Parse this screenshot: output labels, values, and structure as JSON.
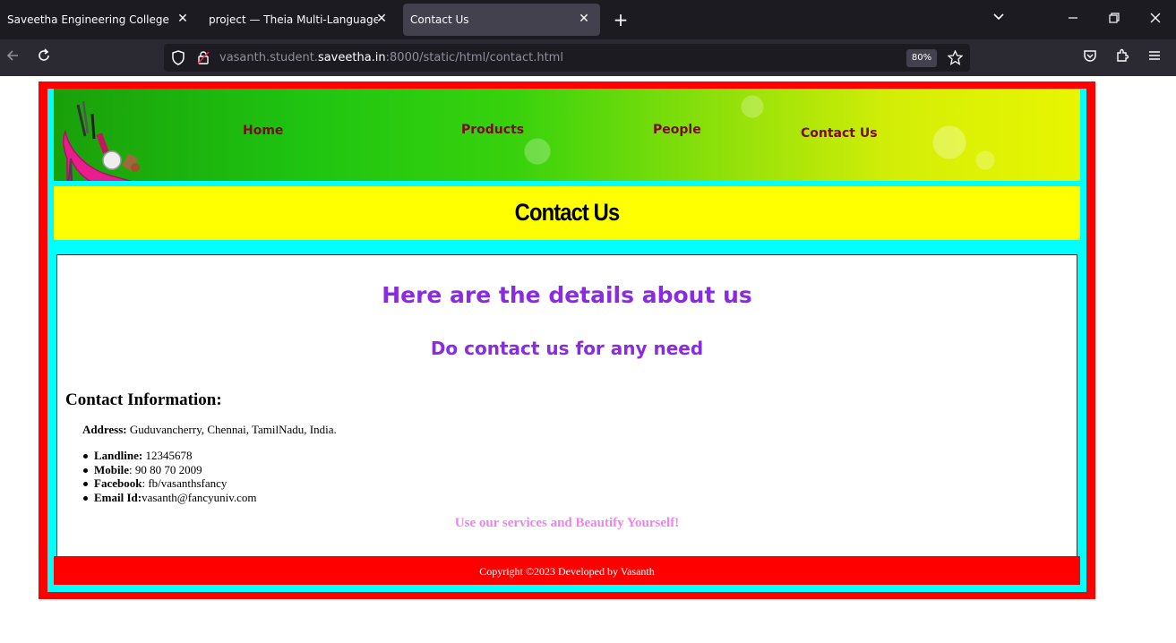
{
  "browser": {
    "tabs": [
      {
        "title": "Saveetha Engineering College"
      },
      {
        "title": "project — Theia Multi-Language Ex"
      },
      {
        "title": "Contact Us"
      }
    ],
    "url": {
      "prefix": "vasanth.student.",
      "host": "saveetha.in",
      "suffix": ":8000/static/html/contact.html"
    },
    "zoom": "80%",
    "icons": [
      "back-icon",
      "reload-icon",
      "shield-icon",
      "lock-icon",
      "star-icon",
      "pocket-icon",
      "extensions-icon",
      "menu-icon",
      "new-tab-icon",
      "tab-list-icon",
      "minimize-icon",
      "restore-icon",
      "close-icon"
    ]
  },
  "site": {
    "nav": {
      "home": "Home",
      "products": "Products",
      "people": "People",
      "contact": "Contact Us"
    },
    "page_title": "Contact Us",
    "heading_main": "Here are the details about us",
    "heading_sub": "Do contact us for any need",
    "contact_heading": "Contact Information:",
    "address": {
      "label": "Address:",
      "value": " Guduvancherry, Chennai, TamilNadu, India."
    },
    "contacts": [
      {
        "label": "Landline:",
        "value": " 12345678"
      },
      {
        "label": "Mobile",
        "value": ": 90 80 70 2009"
      },
      {
        "label": "Facebook",
        "value": ": fb/vasanthsfancy"
      },
      {
        "label": "Email Id:",
        "value": "vasanth@fancyuniv.com"
      }
    ],
    "tagline": "Use our services and Beautify Yourself!",
    "footer": "Copyright ©2023 Developed by Vasanth",
    "colors": {
      "frame": "#ff0000",
      "panel": "#00ffff",
      "title_bar": "#ffff00",
      "heading": "#8a2be2",
      "tagline": "#ee82ee",
      "nav_link": "#7a0a1f"
    }
  }
}
